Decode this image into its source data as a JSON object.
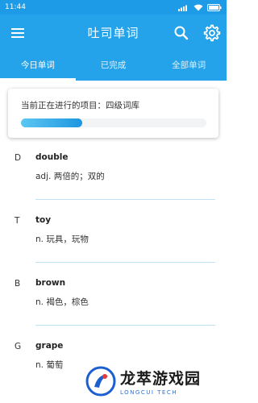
{
  "status_bar": {
    "time": "11:44"
  },
  "toolbar": {
    "title": "吐司单词"
  },
  "tabs": [
    {
      "label": "今日单词",
      "active": true
    },
    {
      "label": "已完成",
      "active": false
    },
    {
      "label": "全部单词",
      "active": false
    }
  ],
  "progress_card": {
    "label": "当前正在进行的项目：",
    "project": "四级词库",
    "progress": 0.33
  },
  "words": [
    {
      "letter": "D",
      "word": "double",
      "meaning": "adj. 两倍的；双的"
    },
    {
      "letter": "T",
      "word": "toy",
      "meaning": "n. 玩具，玩物"
    },
    {
      "letter": "B",
      "word": "brown",
      "meaning": "n. 褐色，棕色"
    },
    {
      "letter": "G",
      "word": "grape",
      "meaning": "n. 葡萄"
    }
  ],
  "watermark": {
    "text_cn": "龙萃游戏园",
    "text_en": "LONGCUI TECH"
  },
  "colors": {
    "primary": "#24a3ea",
    "statusbar": "#1e9be6",
    "progress": "#1e96e0",
    "divider": "#bfe3f5"
  }
}
